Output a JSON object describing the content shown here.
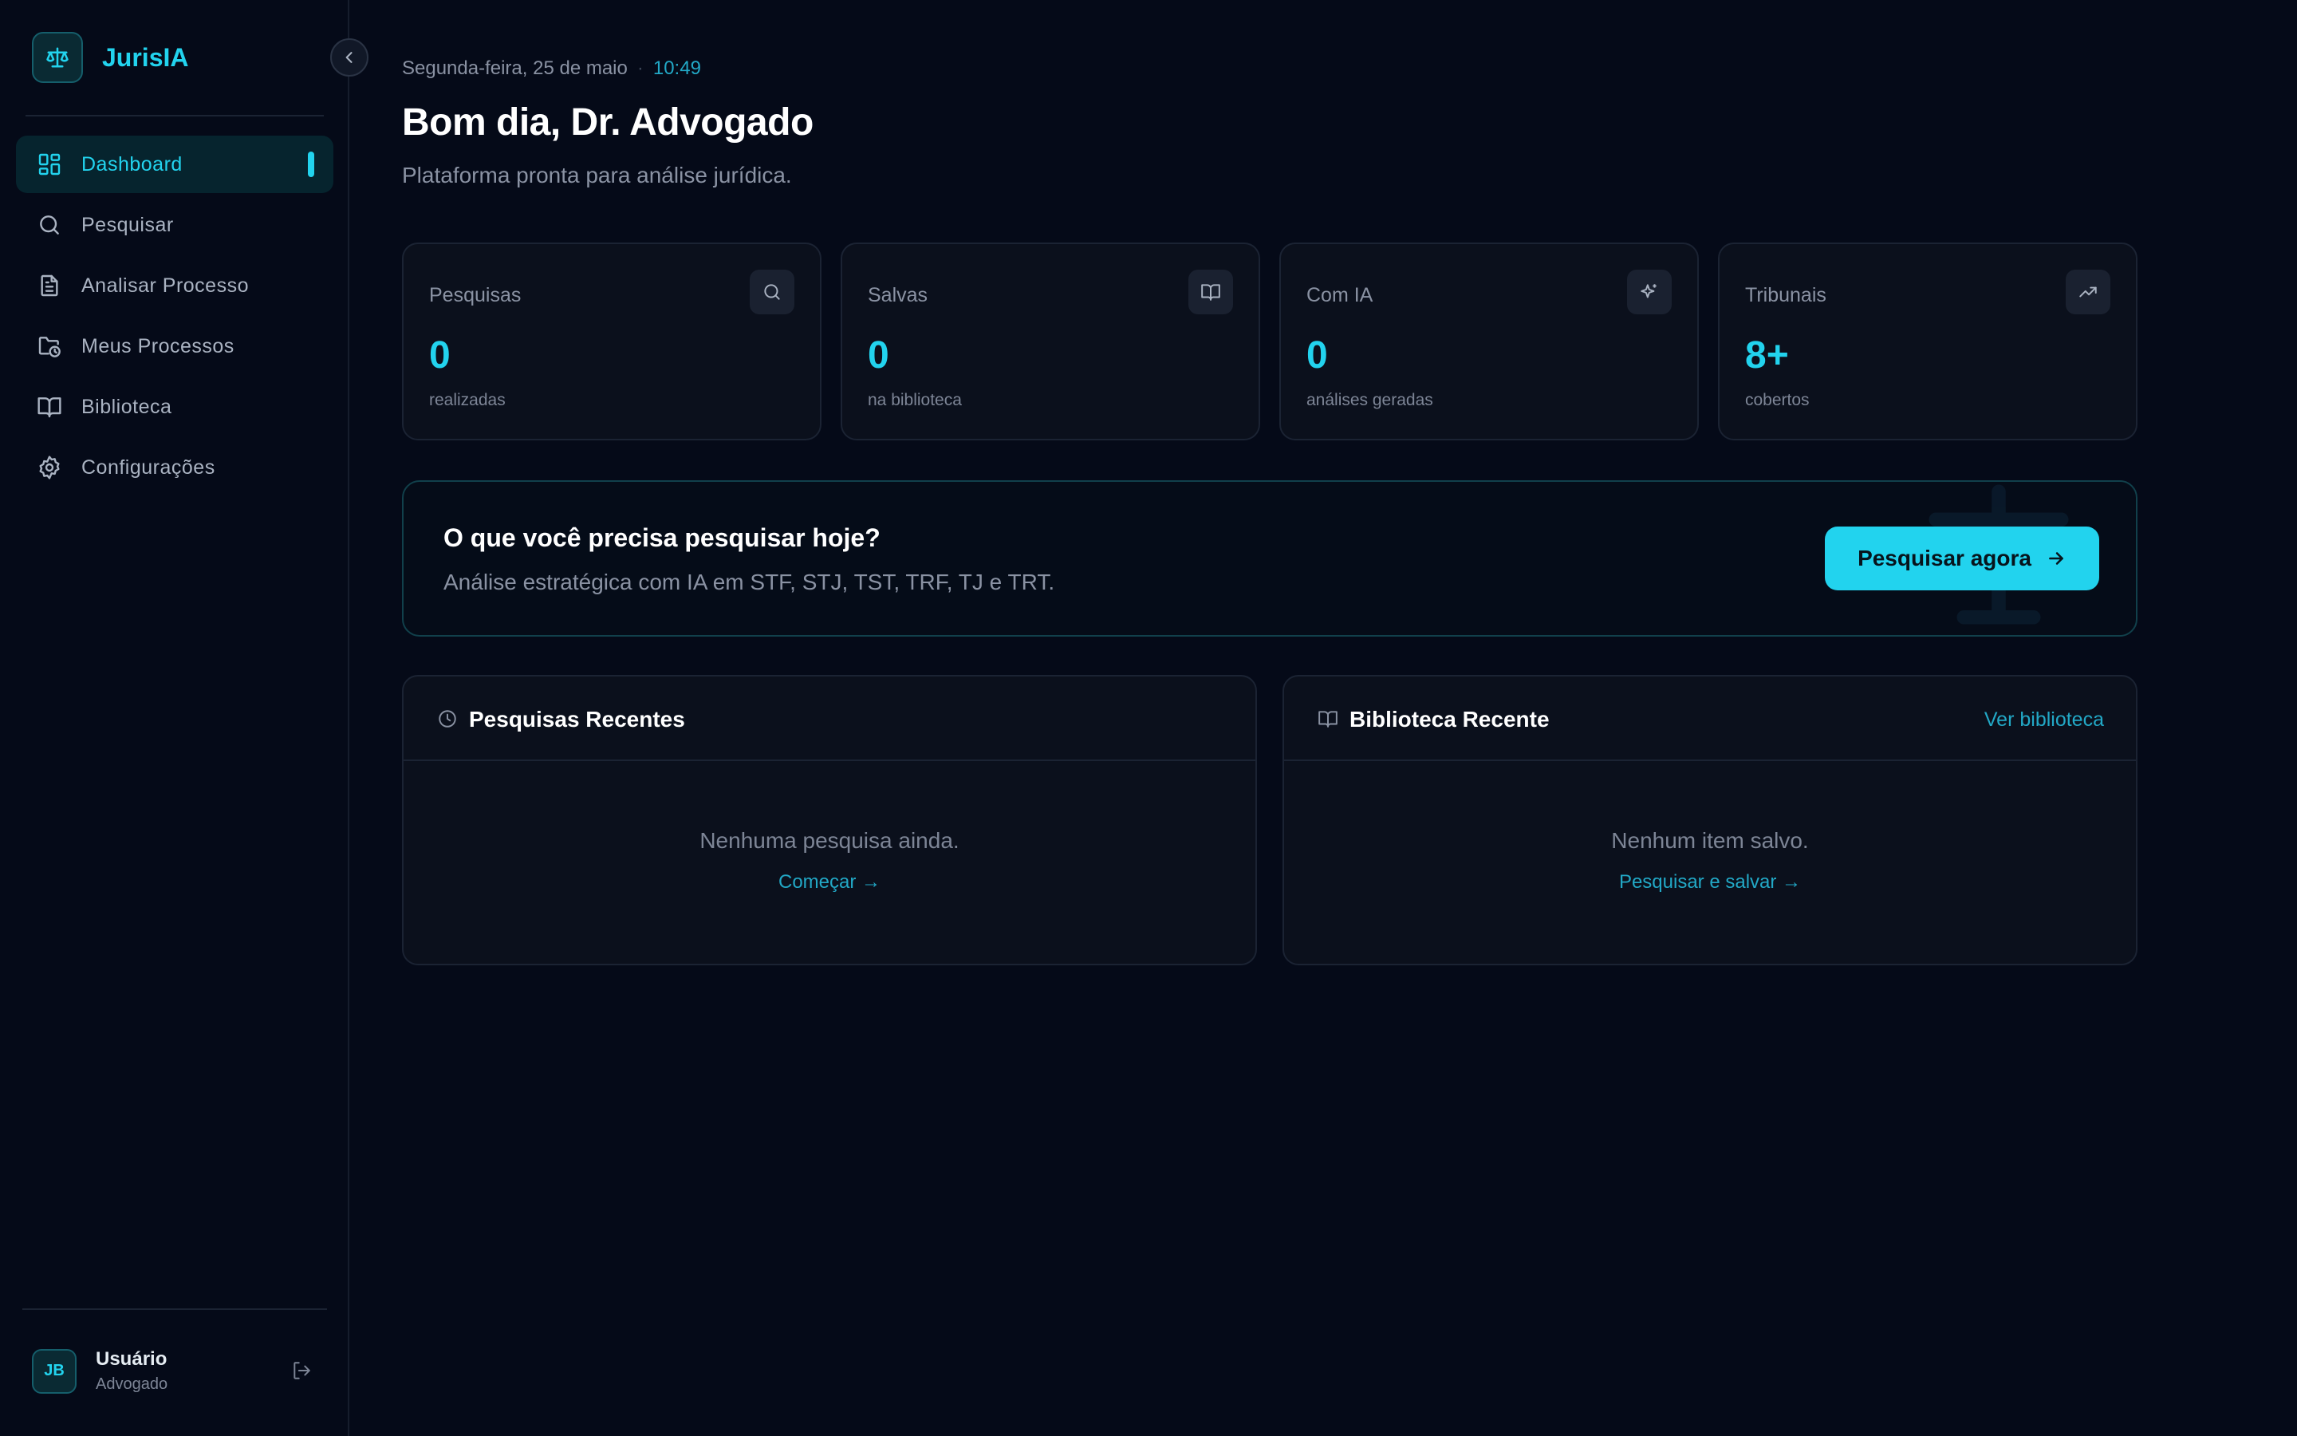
{
  "brand": {
    "name": "JurisIA",
    "logo_icon": "scale-icon"
  },
  "sidebar": {
    "items": [
      {
        "label": "Dashboard",
        "icon": "dashboard-icon",
        "active": true
      },
      {
        "label": "Pesquisar",
        "icon": "search-icon"
      },
      {
        "label": "Analisar Processo",
        "icon": "document-icon"
      },
      {
        "label": "Meus Processos",
        "icon": "folder-clock-icon"
      },
      {
        "label": "Biblioteca",
        "icon": "book-icon"
      },
      {
        "label": "Configurações",
        "icon": "gear-icon"
      }
    ],
    "user": {
      "initials": "JB",
      "name": "Usuário",
      "role": "Advogado"
    }
  },
  "header": {
    "date": "Segunda-feira, 25 de maio",
    "separator": "·",
    "time": "10:49",
    "greeting": "Bom dia, Dr. Advogado",
    "subtitle": "Plataforma pronta para análise jurídica."
  },
  "stats": [
    {
      "label": "Pesquisas",
      "value": "0",
      "sub": "realizadas",
      "icon": "search-icon"
    },
    {
      "label": "Salvas",
      "value": "0",
      "sub": "na biblioteca",
      "icon": "book-icon"
    },
    {
      "label": "Com IA",
      "value": "0",
      "sub": "análises geradas",
      "icon": "sparkles-icon"
    },
    {
      "label": "Tribunais",
      "value": "8+",
      "sub": "cobertos",
      "icon": "trending-up-icon"
    }
  ],
  "cta": {
    "title": "O que você precisa pesquisar hoje?",
    "subtitle": "Análise estratégica com IA em STF, STJ, TST, TRF, TJ e TRT.",
    "button_label": "Pesquisar agora"
  },
  "recent_searches": {
    "title": "Pesquisas Recentes",
    "empty_text": "Nenhuma pesquisa ainda.",
    "empty_link": "Começar →"
  },
  "recent_library": {
    "title": "Biblioteca Recente",
    "link": "Ver biblioteca",
    "empty_text": "Nenhum item salvo.",
    "empty_link": "Pesquisar e salvar →"
  },
  "colors": {
    "accent": "#22d3ee",
    "background": "#050a18",
    "card": "#0b101c"
  }
}
